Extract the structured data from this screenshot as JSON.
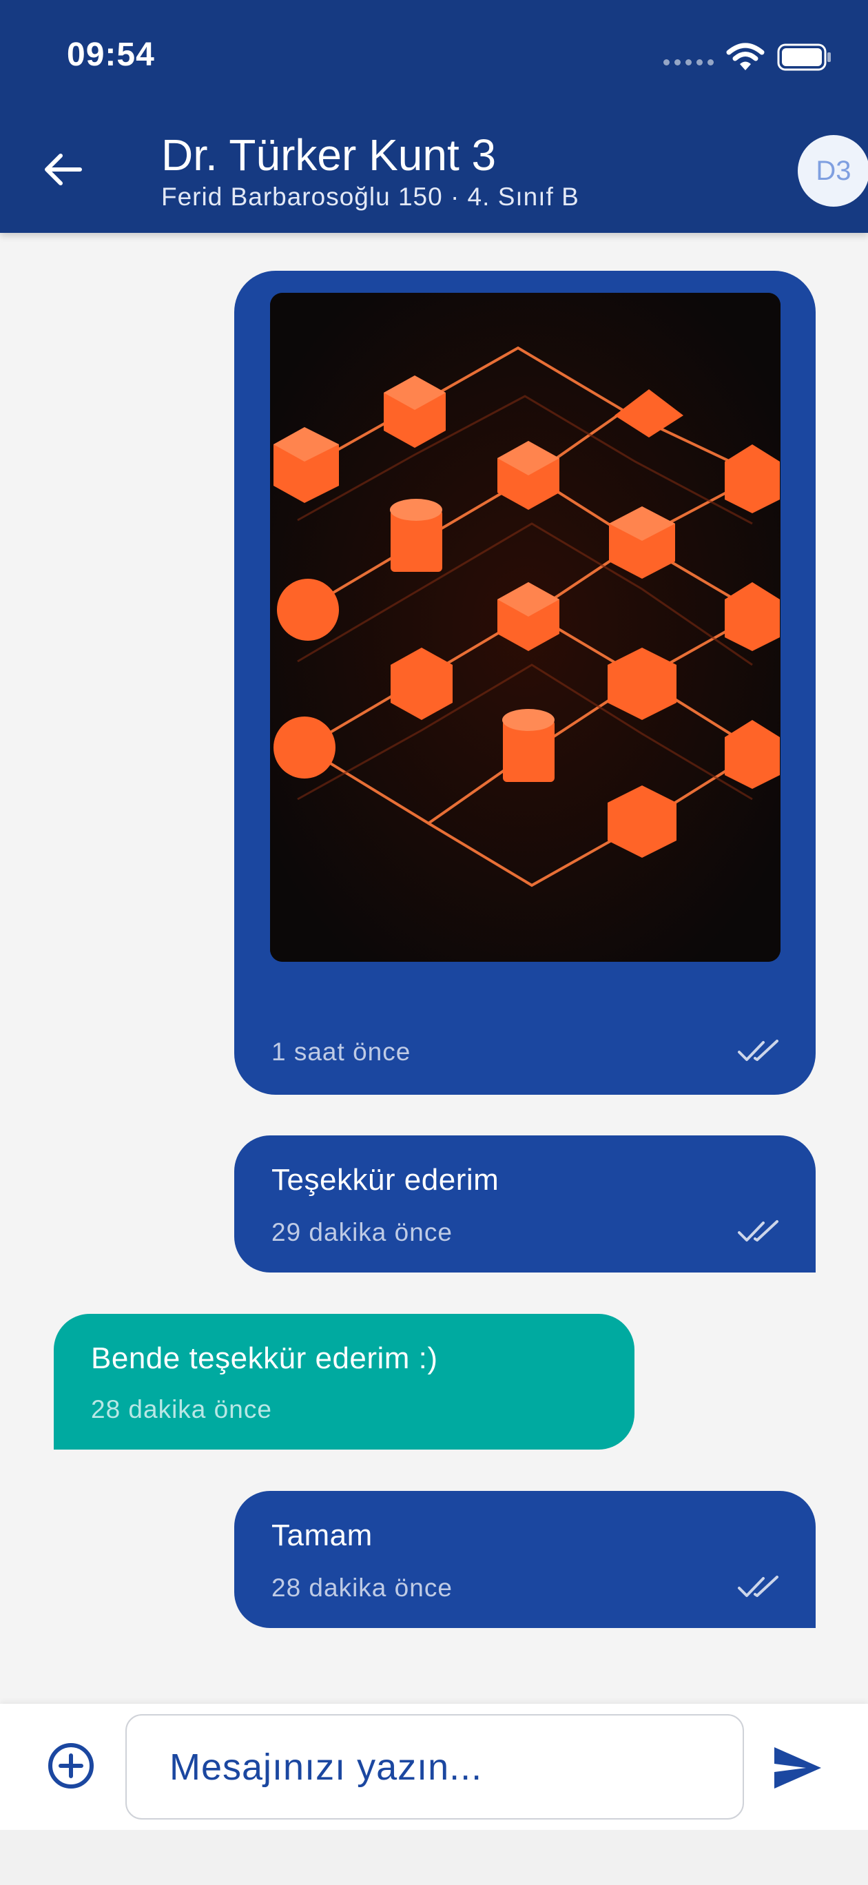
{
  "status_bar": {
    "time": "09:54"
  },
  "header": {
    "back_icon": "arrow-left-icon",
    "title": "Dr. Türker Kunt 3",
    "subtitle": "Ferid Barbarosoğlu 150 · 4. Sınıf B",
    "avatar_initials": "D3"
  },
  "messages": [
    {
      "direction": "outgoing",
      "type": "image",
      "image_description": "orange glowing 3D network of geometric shapes connected by arrows on a dark background",
      "time": "1 saat önce",
      "read_icon": "double-check-icon"
    },
    {
      "direction": "outgoing",
      "type": "text",
      "text": "Teşekkür ederim",
      "time": "29 dakika önce",
      "read_icon": "double-check-icon"
    },
    {
      "direction": "incoming",
      "type": "text",
      "text": "Bende teşekkür ederim :)",
      "time": "28 dakika önce"
    },
    {
      "direction": "outgoing",
      "type": "text",
      "text": "Tamam",
      "time": "28 dakika önce",
      "read_icon": "double-check-icon"
    }
  ],
  "composer": {
    "attach_icon": "plus-circle-icon",
    "placeholder": "Mesajınızı yazın...",
    "value": "",
    "send_icon": "send-icon"
  },
  "colors": {
    "header": "#163a82",
    "outgoing_bubble": "#1b47a0",
    "incoming_bubble": "#00aaa0",
    "background": "#f4f4f4"
  }
}
